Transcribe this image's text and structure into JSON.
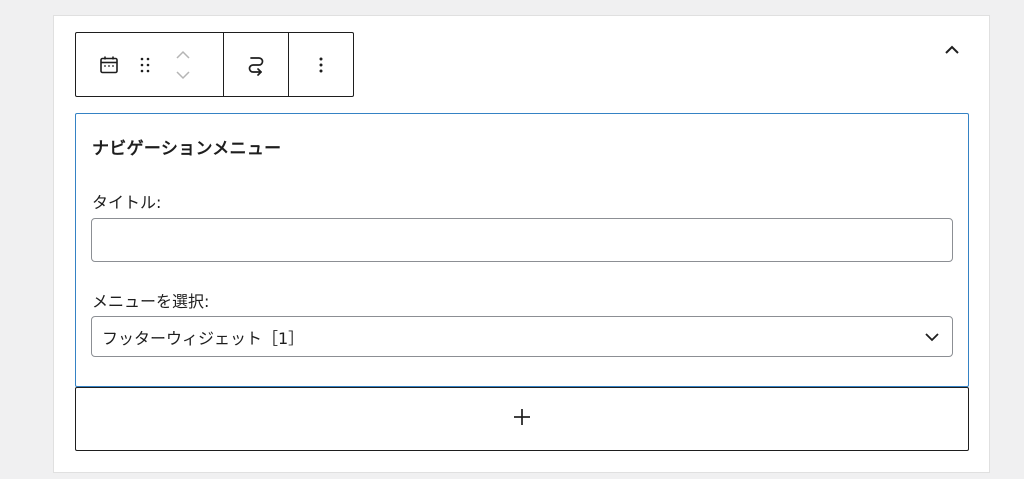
{
  "toolbar": {
    "icons": [
      "calendar-icon",
      "drag-handle-icon",
      "chevron-up-icon",
      "chevron-down-icon",
      "transform-icon",
      "more-vertical-icon"
    ]
  },
  "collapse": {
    "icon": "chevron-up-icon"
  },
  "widget": {
    "title": "ナビゲーションメニュー",
    "title_label": "タイトル:",
    "title_value": "",
    "menu_label": "メニューを選択:",
    "menu_selected": "フッターウィジェット［1］"
  },
  "add_block": {
    "icon": "plus-icon"
  },
  "colors": {
    "background": "#f0f0f1",
    "panel": "#ffffff",
    "accent_border": "#3582c4",
    "text": "#1e1e1e",
    "input_border": "#8c8f94"
  }
}
